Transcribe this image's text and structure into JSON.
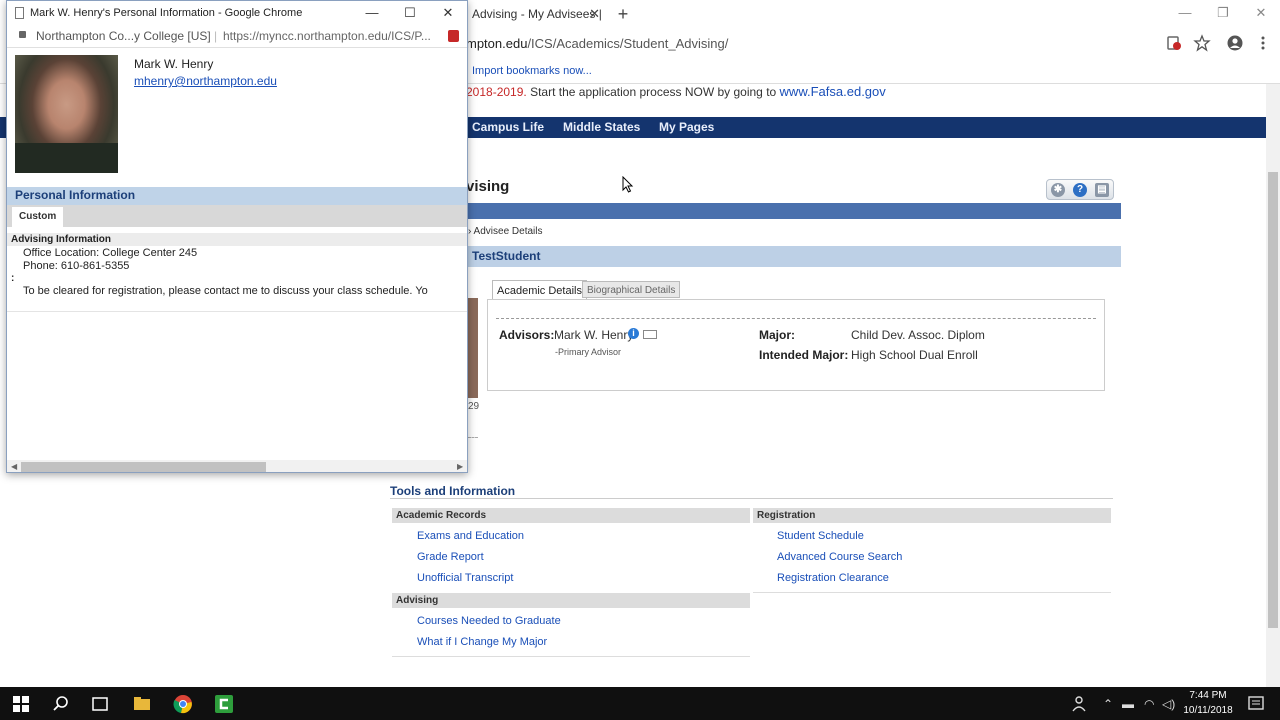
{
  "background_window": {
    "tab_title": "Advising - My Advisees |",
    "tab_close": "✕",
    "new_tab": "+",
    "url_host": "mpton.edu",
    "url_path": "/ICS/Academics/Student_Advising/",
    "bookmarks_link": "Import bookmarks now...",
    "fafsa_year": "2018-2019.",
    "fafsa_text": "Start the application process NOW by going to",
    "fafsa_link": "www.Fafsa.ed.gov",
    "nav_items": [
      "Campus Life",
      "Middle States",
      "My Pages"
    ],
    "page_heading": "vising",
    "breadcrumb": "› Advisee Details",
    "student_name": "TestStudent",
    "photo_caption": "29",
    "tabs": {
      "academic": "Academic Details",
      "biographical": "Biographical Details"
    },
    "details": {
      "advisors_label": "Advisors:",
      "advisor_name": "Mark W. Henry",
      "advisor_role": "-Primary Advisor",
      "major_label": "Major:",
      "major_value": "Child Dev. Assoc. Diplom",
      "intended_label": "Intended Major:",
      "intended_value": "High School Dual Enroll"
    },
    "tools": {
      "title": "Tools and Information",
      "academic_records": {
        "heading": "Academic Records",
        "links": [
          "Exams and Education",
          "Grade Report",
          "Unofficial Transcript"
        ]
      },
      "registration": {
        "heading": "Registration",
        "links": [
          "Student Schedule",
          "Advanced Course Search",
          "Registration Clearance"
        ]
      },
      "advising": {
        "heading": "Advising",
        "links": [
          "Courses Needed to Graduate",
          "What if I Change My Major"
        ]
      }
    }
  },
  "popup": {
    "window_title": "Mark W. Henry's Personal Information - Google Chrome",
    "url_site": "Northampton Co...y College [US]",
    "url_path": "https://myncc.northampton.edu/ICS/P...",
    "name": "Mark W. Henry",
    "email": "mhenry@northampton.edu",
    "section_title": "Personal Information",
    "custom_tab": "Custom",
    "advising_title": "Advising Information",
    "office": "Office Location:  College Center 245",
    "phone": "Phone:  610-861-5355",
    "colon": ":",
    "note": "To be cleared for registration, please contact me to discuss your class schedule.  Yo"
  },
  "taskbar": {
    "time": "7:44 PM",
    "date": "10/11/2018"
  },
  "colors": {
    "navbar": "#14346e",
    "section_bar": "#4a70ad",
    "link": "#1a4fb8"
  }
}
